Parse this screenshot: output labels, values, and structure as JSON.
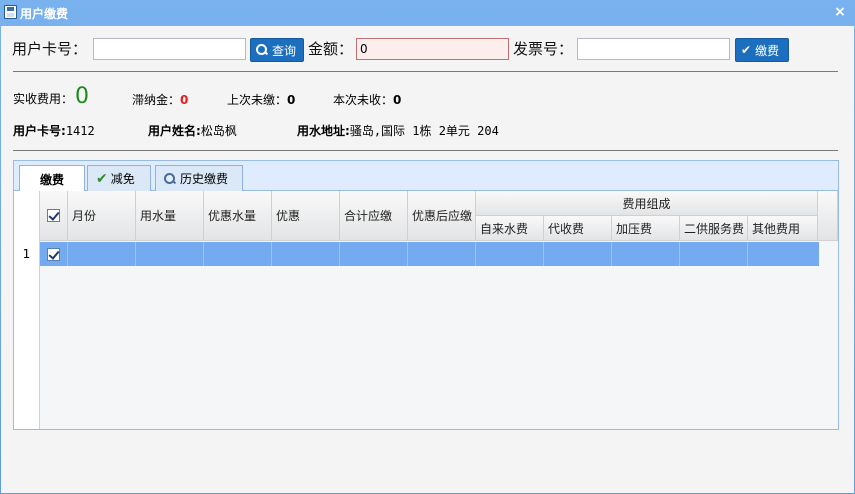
{
  "window": {
    "title": "用户缴费",
    "close": "×"
  },
  "form": {
    "card_label": "用户卡号：",
    "card_value": "",
    "search_label": "查询",
    "amount_label": "金额：",
    "amount_value": "0",
    "invoice_label": "发票号：",
    "invoice_value": "",
    "pay_label": "缴费"
  },
  "summary": {
    "received_label": "实收费用：",
    "received_value": "0",
    "latefee_label": "滞纳金：",
    "latefee_value": "0",
    "last_unpaid_label": "上次未缴：",
    "last_unpaid_value": "0",
    "this_unpaid_label": "本次未收：",
    "this_unpaid_value": "0"
  },
  "user": {
    "card_label": "用户卡号:",
    "card_value": "1412",
    "name_label": "用户姓名:",
    "name_value": "松岛枫",
    "address_label": "用水地址:",
    "address_value": "骚岛,国际 1栋 2单元 204"
  },
  "tabs": [
    {
      "label": "缴费"
    },
    {
      "label": "减免"
    },
    {
      "label": "历史缴费"
    }
  ],
  "grid": {
    "columns": [
      "月份",
      "用水量",
      "优惠水量",
      "优惠",
      "合计应缴",
      "优惠后应缴"
    ],
    "group_header": "费用组成",
    "sub_columns": [
      "自来水费",
      "代收费",
      "加压费",
      "二供服务费",
      "其他费用"
    ],
    "rows": [
      {
        "num": "1"
      }
    ]
  },
  "colors": {
    "title_bar": "#6fa7e3",
    "selected_row": "#73aaf0",
    "button": "#1c6ebf"
  }
}
